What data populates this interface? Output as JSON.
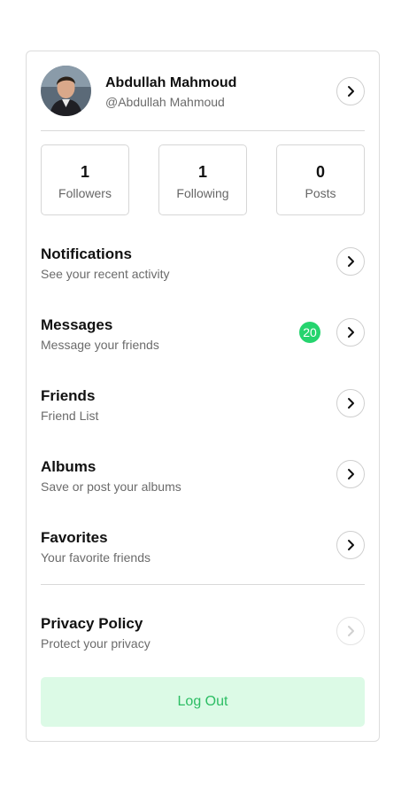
{
  "profile": {
    "name": "Abdullah Mahmoud",
    "handle": "@Abdullah Mahmoud"
  },
  "stats": [
    {
      "value": "1",
      "label": "Followers"
    },
    {
      "value": "1",
      "label": "Following"
    },
    {
      "value": "0",
      "label": "Posts"
    }
  ],
  "menu": [
    {
      "title": "Notifications",
      "subtitle": "See your recent activity"
    },
    {
      "title": "Messages",
      "subtitle": "Message your friends",
      "badge": "20"
    },
    {
      "title": "Friends",
      "subtitle": "Friend List"
    },
    {
      "title": "Albums",
      "subtitle": "Save or post your albums"
    },
    {
      "title": "Favorites",
      "subtitle": "Your favorite friends"
    },
    {
      "title": "Privacy Policy",
      "subtitle": "Protect your privacy"
    }
  ],
  "logout_label": "Log Out",
  "colors": {
    "badge": "#25d46e",
    "logout_bg": "#dcfae6",
    "logout_text": "#2bbd63"
  },
  "icons": {
    "chevron": "chevron-right-icon"
  }
}
